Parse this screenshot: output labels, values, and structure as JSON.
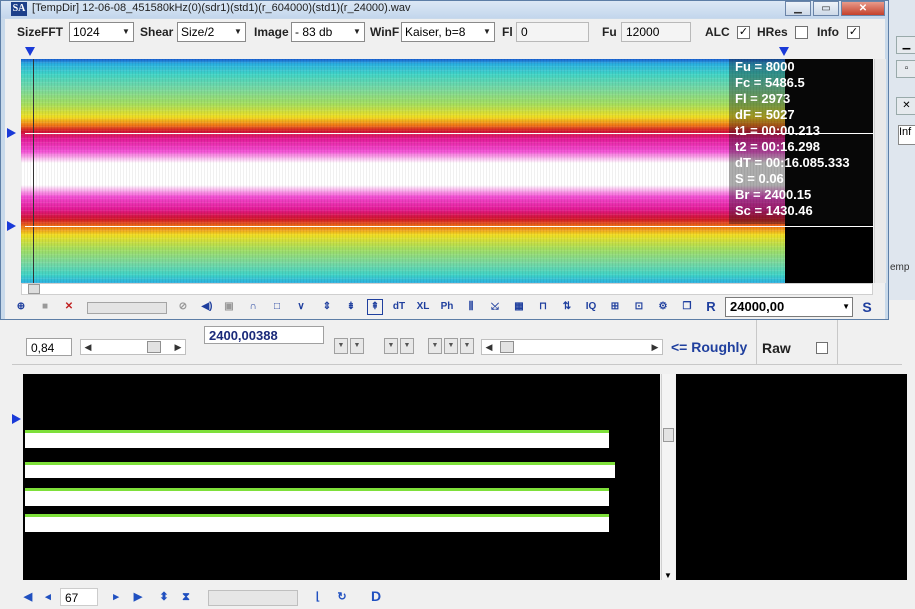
{
  "window": {
    "app_icon": "SA",
    "title": "[TempDir] 12-06-08_451580kHz(0)(sdr1)(std1)(r_604000)(std1)(r_24000).wav",
    "controls": [
      "minimize-icon",
      "maximize-icon",
      "close-icon"
    ]
  },
  "toolbar": {
    "sizefft_label": "SizeFFT",
    "sizefft_value": "1024",
    "shear_label": "Shear",
    "shear_value": "Size/2",
    "image_label": "Image",
    "image_value": "- 83 db",
    "winf_label": "WinF",
    "winf_value": "Kaiser, b=8",
    "fl_label": "Fl",
    "fl_value": "0",
    "fu_label": "Fu",
    "fu_value": "12000",
    "alc_label": "ALC",
    "alc_checked": true,
    "hres_label": "HRes",
    "hres_checked": false,
    "info_label": "Info",
    "info_checked": true
  },
  "info_overlay": [
    "Fu = 8000",
    "Fc = 5486.5",
    "Fl = 2973",
    "dF = 5027",
    "t1 = 00:00.213",
    "t2 = 00:16.298",
    "dT = 00:16.085.333",
    "S = 0.06",
    "Br = 2400.15",
    "Sc = 1430.46"
  ],
  "spectrum_colors": {
    "low": "#2ab0e0",
    "mid": "#f0de22",
    "high": "#d0152a",
    "peak": "#e31a96",
    "max": "#ffffff"
  },
  "bottom_toolbar": {
    "icons": [
      "zoom-in-icon",
      "square-icon",
      "delete-icon",
      "slider-icon",
      "no-icon",
      "speaker-icon",
      "stop-icon",
      "arc-icon",
      "rect-icon",
      "v-icon",
      "up-down-icon",
      "split-icon",
      "merge-icon",
      "dt-icon",
      "xl-icon",
      "ph-icon",
      "comb-icon",
      "cross-icon",
      "grid-icon",
      "pulse-icon",
      "updown-arrows-icon",
      "iq-icon",
      "pattern-icon",
      "pattern2-icon",
      "gear-icon",
      "copy-icon",
      "r-icon"
    ],
    "dt_label": "dT",
    "xl_label": "XL",
    "ph_label": "Ph",
    "iq_label": "IQ",
    "r_label": "R",
    "fs_value": "24000,00",
    "s_label": "S"
  },
  "main": {
    "field_a": "0,84",
    "field_b": "2400,00388",
    "roughly_label": "<= Roughly",
    "raw_label": "Raw",
    "raw_checked": false,
    "page_value": "67",
    "d_label": "D",
    "side_tab": "Inf",
    "side_tab2": "emp"
  }
}
